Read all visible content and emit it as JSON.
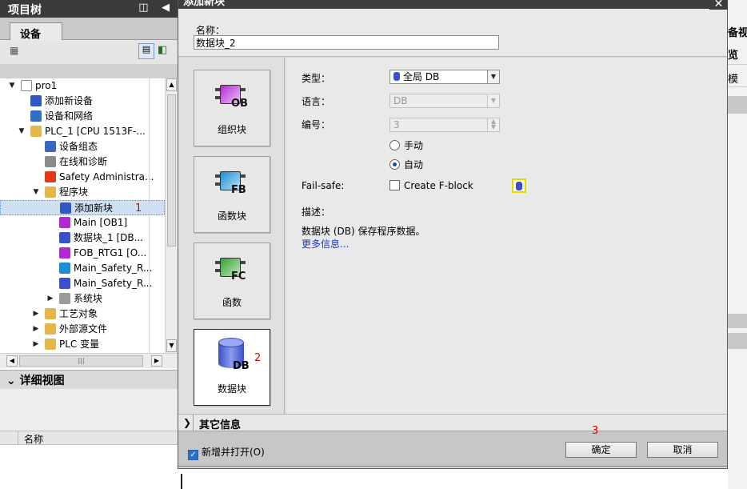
{
  "project_tree": {
    "title": "项目树",
    "header_buttons": "◫ ◀",
    "tab_devices": "设备",
    "items": [
      {
        "label": "pro1",
        "expander": "▼",
        "icon": "project-file-icon",
        "color": "#ffffff"
      },
      {
        "label": "添加新设备",
        "expander": "",
        "icon": "add-device-icon",
        "color": "#2f58c5"
      },
      {
        "label": "设备和网络",
        "expander": "",
        "icon": "network-icon",
        "color": "#2f6fc5"
      },
      {
        "label": "PLC_1 [CPU 1513F-...",
        "expander": "▼",
        "icon": "plc-folder-icon",
        "color": "#e3b74a"
      },
      {
        "label": "设备组态",
        "expander": "",
        "icon": "device-config-icon",
        "color": "#3a66c2"
      },
      {
        "label": "在线和诊断",
        "expander": "",
        "icon": "online-diagnostics-icon",
        "color": "#8a8a8a"
      },
      {
        "label": "Safety Administra...",
        "expander": "",
        "icon": "safety-icon",
        "color": "#e03a1c"
      },
      {
        "label": "程序块",
        "expander": "▼",
        "icon": "program-blocks-folder-icon",
        "color": "#e3b74a"
      },
      {
        "label": "添加新块",
        "expander": "",
        "icon": "add-block-icon",
        "color": "#2f58c5",
        "selected": true,
        "marker": "1"
      },
      {
        "label": "Main [OB1]",
        "expander": "",
        "icon": "ob-icon",
        "color": "#b02ad0"
      },
      {
        "label": "数据块_1 [DB...",
        "expander": "",
        "icon": "db-icon",
        "color": "#3a4fc9"
      },
      {
        "label": "FOB_RTG1 [O...",
        "expander": "",
        "icon": "ob-safety-icon",
        "color": "#b02ad0"
      },
      {
        "label": "Main_Safety_R...",
        "expander": "",
        "icon": "fb-safety-icon",
        "color": "#1b8fd1"
      },
      {
        "label": "Main_Safety_R...",
        "expander": "",
        "icon": "db-safety-icon",
        "color": "#3a4fc9"
      },
      {
        "label": "系统块",
        "expander": "▶",
        "icon": "system-blocks-icon",
        "color": "#9a9a9a"
      },
      {
        "label": "工艺对象",
        "expander": "▶",
        "icon": "technology-objects-icon",
        "color": "#e3b74a"
      },
      {
        "label": "外部源文件",
        "expander": "▶",
        "icon": "external-sources-icon",
        "color": "#e3b74a"
      },
      {
        "label": "PLC 变量",
        "expander": "▶",
        "icon": "plc-tags-icon",
        "color": "#e3b74a"
      }
    ],
    "hscroll_thumb": "|||"
  },
  "detail_view": {
    "title": "详细视图",
    "expander": "⌄",
    "column_name": "名称"
  },
  "background_panel": {
    "labels": [
      "备视",
      "览",
      "模"
    ]
  },
  "dialog": {
    "title": "添加新块",
    "close": "✕",
    "name_label": "名称：",
    "name_value": "数据块_2",
    "block_types": [
      {
        "label": "组织块",
        "tag": "OB",
        "icon": "ob-block-icon",
        "color": "#b52ad6"
      },
      {
        "label": "函数块",
        "tag": "FB",
        "icon": "fb-block-icon",
        "color": "#1b8fd1"
      },
      {
        "label": "函数",
        "tag": "FC",
        "icon": "fc-block-icon",
        "color": "#2fa32f"
      },
      {
        "label": "数据块",
        "tag": "DB",
        "icon": "db-block-icon",
        "color": "#3a4fc9",
        "selected": true,
        "marker": "2"
      }
    ],
    "type_label": "类型：",
    "type_value": "全局 DB",
    "language_label": "语言：",
    "language_value": "DB",
    "number_label": "编号：",
    "number_value": "3",
    "radio_manual": "手动",
    "radio_auto": "自动",
    "failsafe_label": "Fail-safe:",
    "create_fblock": "Create F-block",
    "description_label": "描述：",
    "description_text": "数据块 (DB) 保存程序数据。",
    "more_info_link": "更多信息...",
    "more_info_section": "其它信息",
    "add_and_open": "新增并打开(O)",
    "marker_ok": "3",
    "ok": "确定",
    "cancel": "取消"
  }
}
